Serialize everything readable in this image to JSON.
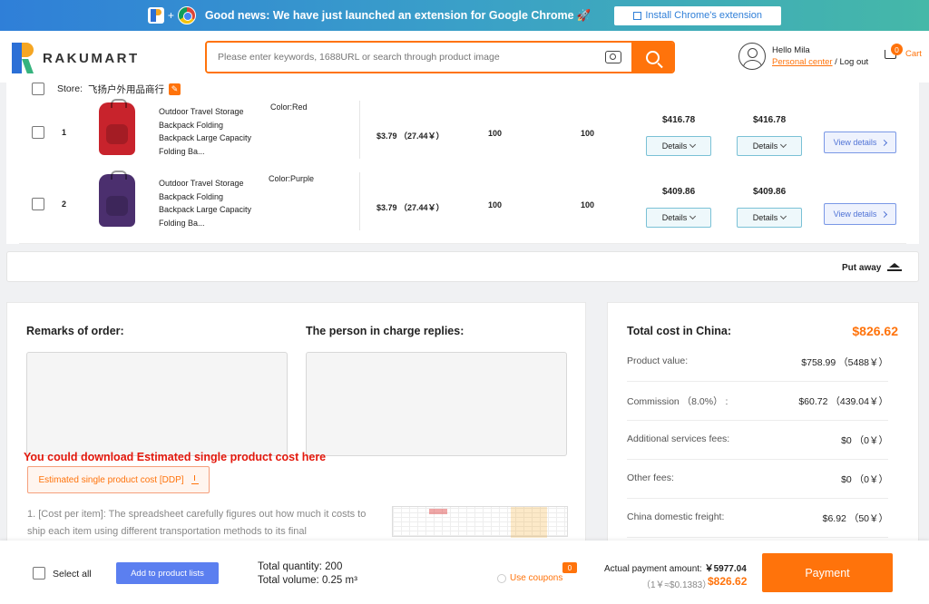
{
  "banner": {
    "text": "Good news: We have just launched an extension for Google Chrome",
    "install_label": "Install Chrome's extension"
  },
  "header": {
    "brand": "RAKUMART",
    "search_placeholder": "Please enter keywords, 1688URL or search through product image",
    "greeting": "Hello Mila",
    "personal_center": "Personal center",
    "separator": " / ",
    "logout": "Log out",
    "cart_count": "0",
    "cart_label": "Cart"
  },
  "store": {
    "label": "Store:",
    "name": "飞扬户外用品商行"
  },
  "products": [
    {
      "index": "1",
      "name": "Outdoor Travel Storage Backpack Folding Backpack Large Capacity Folding Ba...",
      "color": "Color:Red",
      "bag_color": "#c8232c",
      "price": "$3.79 （27.44￥）",
      "qty1": "100",
      "qty2": "100",
      "total1": "$416.78",
      "total2": "$416.78",
      "details1": "Details",
      "details2": "Details",
      "view": "View details"
    },
    {
      "index": "2",
      "name": "Outdoor Travel Storage Backpack Folding Backpack Large Capacity Folding Ba...",
      "color": "Color:Purple",
      "bag_color": "#4b2f6e",
      "price": "$3.79 （27.44￥）",
      "qty1": "100",
      "qty2": "100",
      "total1": "$409.86",
      "total2": "$409.86",
      "details1": "Details",
      "details2": "Details",
      "view": "View details"
    }
  ],
  "put_away": "Put away",
  "remarks": {
    "title": "Remarks of order:",
    "reply_title": "The person in charge replies:",
    "download_note": "You could download Estimated single product cost here",
    "estimate_button": "Estimated single product cost [DDP]",
    "description": "1. [Cost per item]: The spreadsheet carefully figures out how much it costs to ship each item using different transportation methods to its final"
  },
  "cost": {
    "title": "Total cost in China:",
    "total": "$826.62",
    "rows": [
      {
        "label": "Product value:",
        "value": "$758.99 （5488￥）"
      },
      {
        "label": "Commission （8.0%） :",
        "value": "$60.72 （439.04￥）"
      },
      {
        "label": "Additional services fees:",
        "value": "$0 （0￥）"
      },
      {
        "label": "Other fees:",
        "value": "$0 （0￥）"
      },
      {
        "label": "China domestic freight:",
        "value": "$6.92 （50￥）"
      }
    ]
  },
  "footer": {
    "select_all": "Select all",
    "add_to_lists": "Add to product lists",
    "total_quantity": "Total quantity:  200",
    "total_volume": "Total volume:  0.25 m³",
    "coupons": "Use coupons",
    "coupon_count": "0",
    "actual_label": "Actual payment amount: ",
    "actual_value": "￥5977.04",
    "rate": "（1￥≈$0.1383）",
    "usd": "$826.62",
    "payment": "Payment"
  },
  "colors": {
    "accent": "#ff730b",
    "blue_button": "#5b7ff0",
    "note_red": "#e3180c"
  }
}
